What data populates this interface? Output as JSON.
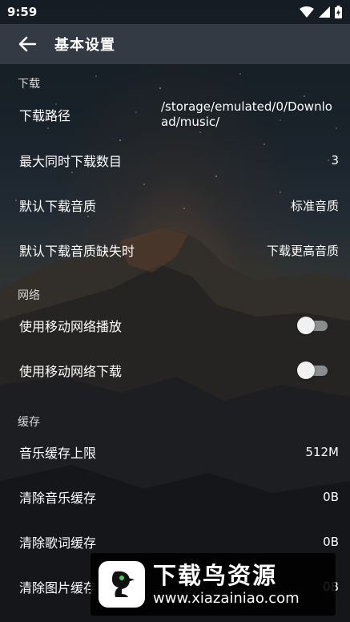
{
  "status_bar": {
    "time": "9:59"
  },
  "toolbar": {
    "title": "基本设置",
    "back_icon": "arrow-left-icon"
  },
  "sections": {
    "download": {
      "header": "下载",
      "path_label": "下载路径",
      "path_value": "/storage/emulated/0/Download/music/",
      "max_label": "最大同时下载数目",
      "max_value": "3",
      "quality_label": "默认下载音质",
      "quality_value": "标准音质",
      "missing_label": "默认下载音质缺失时",
      "missing_value": "下载更高音质"
    },
    "network": {
      "header": "网络",
      "play_label": "使用移动网络播放",
      "play_enabled": false,
      "download_label": "使用移动网络下载",
      "download_enabled": false
    },
    "cache": {
      "header": "缓存",
      "limit_label": "音乐缓存上限",
      "limit_value": "512M",
      "clear_music_label": "清除音乐缓存",
      "clear_music_value": "0B",
      "clear_lyrics_label": "清除歌词缓存",
      "clear_lyrics_value": "0B",
      "clear_images_label": "清除图片缓存",
      "clear_images_value": "0B"
    }
  },
  "watermark": {
    "title": "下载鸟资源",
    "url": "www.xiazainiao.com"
  },
  "colors": {
    "toolbar": "#333a44",
    "switch_track": "#8a8d90",
    "switch_thumb": "#f1f1f1"
  }
}
